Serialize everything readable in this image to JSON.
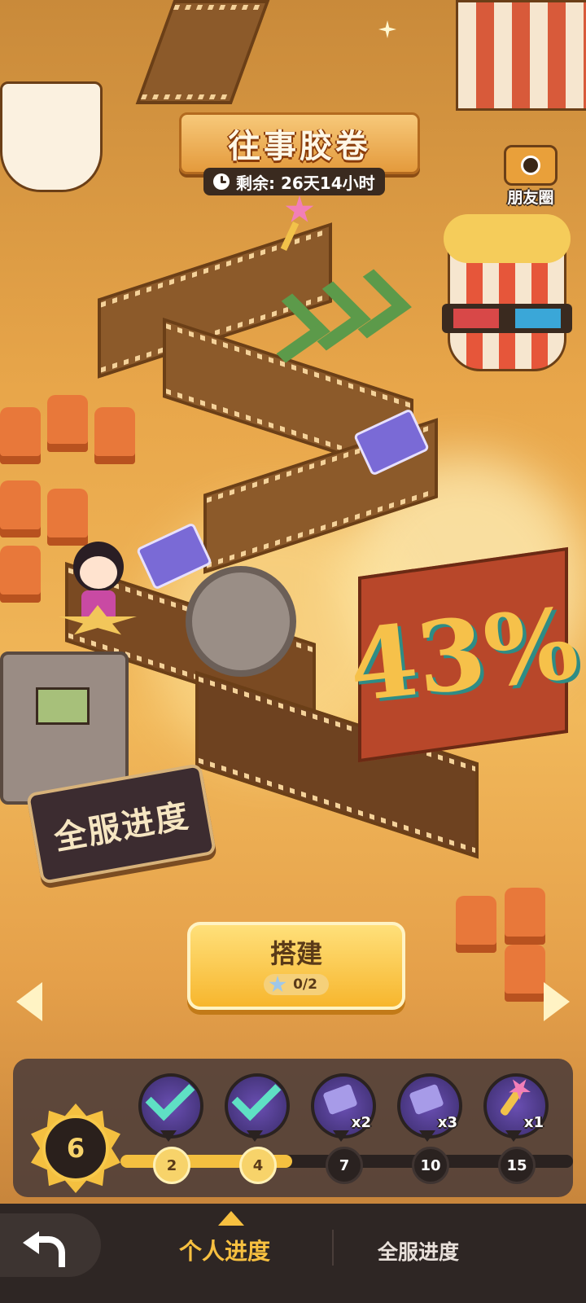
{
  "event": {
    "title": "往事胶卷",
    "remaining": "剩余: 26天14小时"
  },
  "friends_label": "朋友圈",
  "server_progress": {
    "percent": "43%",
    "sign_label": "全服进度"
  },
  "build": {
    "label": "搭建",
    "count": "0/2"
  },
  "level": "6",
  "progress": {
    "fill_fraction": 0.38,
    "milestones": [
      {
        "value": "2",
        "state": "claimed",
        "reward_icon": "wand-icon",
        "mult": ""
      },
      {
        "value": "4",
        "state": "claimed",
        "reward_icon": "reel-icon",
        "mult": ""
      },
      {
        "value": "7",
        "state": "locked",
        "reward_icon": "ticket-icon",
        "mult": "x2"
      },
      {
        "value": "10",
        "state": "locked",
        "reward_icon": "ticket-icon",
        "mult": "x3"
      },
      {
        "value": "15",
        "state": "locked",
        "reward_icon": "key-wand-icon",
        "mult": "x1"
      }
    ]
  },
  "tabs": {
    "personal": "个人进度",
    "server": "全服进度"
  },
  "colors": {
    "accent": "#f7c040",
    "panel": "#483a38",
    "check": "#5fe0c4"
  }
}
